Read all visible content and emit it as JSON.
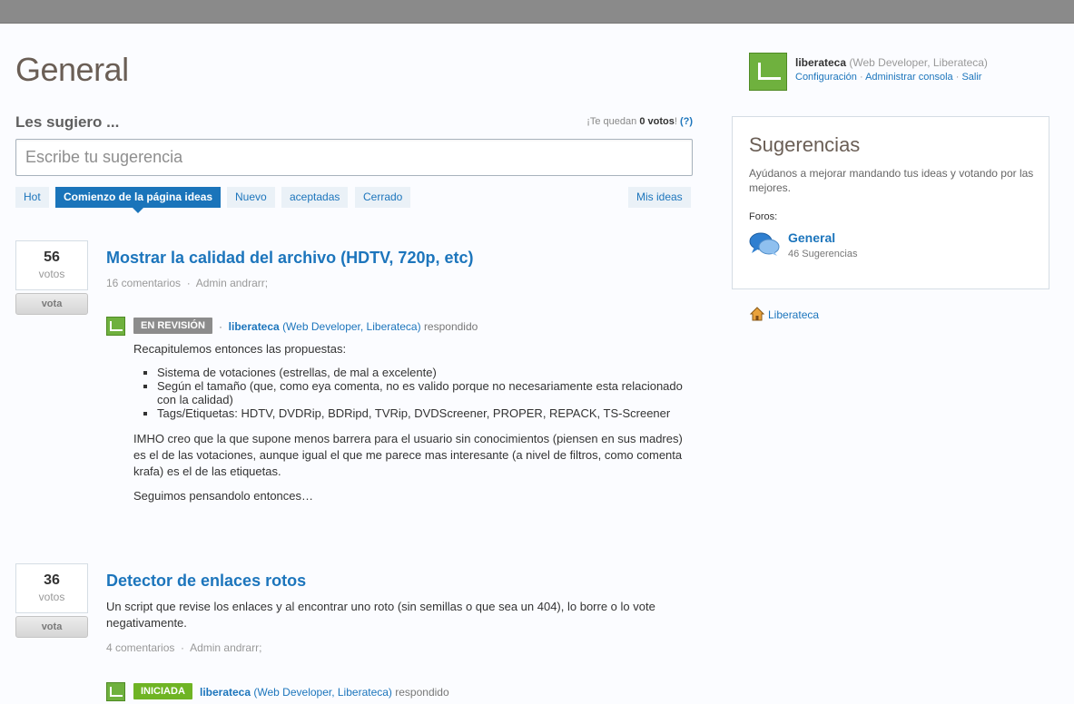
{
  "page": {
    "title": "General"
  },
  "suggest": {
    "label": "Les sugiero ...",
    "votes_left_prefix": "¡Te quedan",
    "votes_left_value": "0 votos",
    "votes_left_suffix": "!",
    "help_link": "(?)",
    "placeholder": "Escribe tu sugerencia"
  },
  "tabs": [
    {
      "label": "Hot",
      "active": false
    },
    {
      "label": "Comienzo de la página ideas",
      "active": true
    },
    {
      "label": "Nuevo",
      "active": false
    },
    {
      "label": "aceptadas",
      "active": false
    },
    {
      "label": "Cerrado",
      "active": false
    },
    {
      "label": "Mis ideas",
      "active": false
    }
  ],
  "ideas": [
    {
      "votes": "56",
      "votes_word": "votos",
      "vote_label": "vota",
      "title": "Mostrar la calidad del archivo (HDTV, 720p, etc)",
      "comments": "16 comentarios",
      "sep": "·",
      "admin_link": "Admin andrarr;",
      "status": "EN REVISIÓN",
      "responder": "liberateca",
      "responder_role": "(Web Developer, Liberateca)",
      "responded": "respondido",
      "response_intro": "Recapitulemos entonces las propuestas:",
      "response_list": [
        "Sistema de votaciones (estrellas, de mal a excelente)",
        "Según el tamaño (que, como eya comenta, no es valido porque no necesariamente esta relacionado con la calidad)",
        "Tags/Etiquetas: HDTV, DVDRip, BDRipd, TVRip, DVDScreener, PROPER, REPACK, TS-Screener"
      ],
      "response_p2": "IMHO creo que la que supone menos barrera para el usuario sin conocimientos (piensen en sus madres) es el de las votaciones, aunque igual el que me parece mas interesante (a nivel de filtros, como comenta krafa) es el de las etiquetas.",
      "response_p3": "Seguimos pensandolo entonces…"
    },
    {
      "votes": "36",
      "votes_word": "votos",
      "vote_label": "vota",
      "title": "Detector de enlaces rotos",
      "description": "Un script que revise los enlaces y al encontrar uno roto (sin semillas o que sea un 404), lo borre o lo vote negativamente.",
      "comments": "4 comentarios",
      "sep": "·",
      "admin_link": "Admin andrarr;",
      "status": "INICIADA",
      "responder": "liberateca",
      "responder_role": "(Web Developer, Liberateca)",
      "responded": "respondido"
    }
  ],
  "user": {
    "name": "liberateca",
    "role": "(Web Developer, Liberateca)",
    "links": [
      "Configuración",
      "Administrar consola",
      "Salir"
    ],
    "sep": "·"
  },
  "sidebar": {
    "title": "Sugerencias",
    "description": "Ayúdanos a mejorar mandando tus ideas y votando por las mejores.",
    "foros_label": "Foros:",
    "forum_name": "General",
    "forum_count": "46 Sugerencias",
    "home_link": "Liberateca"
  },
  "colors": {
    "accent": "#1c75bc",
    "status_review": "#8c8c8c",
    "status_started": "#6fb424",
    "title_brown": "#6a5e55"
  }
}
